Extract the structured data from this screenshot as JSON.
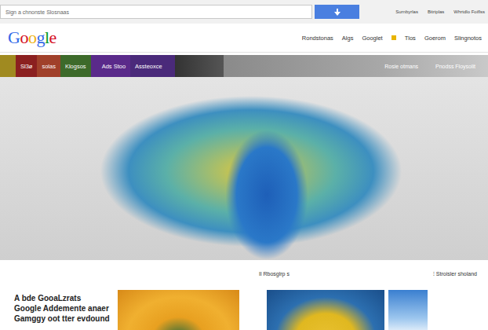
{
  "search": {
    "value": "Sign a chnonste Slosnaas"
  },
  "top_links": [
    "Surnbyrlas",
    "Bitriplas",
    "Whrtdlo Foiflss"
  ],
  "logo": "Google",
  "nav": [
    "Rondstonas",
    "Algs",
    "Googlet",
    "Tlos",
    "Goerom",
    "Slingnotos"
  ],
  "tabs": [
    {
      "label": "Sl3ø",
      "selected": false,
      "color": "#8b2020"
    },
    {
      "label": "solas",
      "selected": false,
      "color": "#a0402a"
    },
    {
      "label": "Klogsos",
      "selected": false,
      "color": "#3d6a2a"
    },
    {
      "label": "Ads Stoo",
      "selected": false,
      "color": "#5a2a8a"
    },
    {
      "label": "Assteoxce",
      "selected": false,
      "color": "#4a2a7a"
    }
  ],
  "tab_right": [
    "Rosie otmans",
    "Pnodss Floysolit"
  ],
  "captions": [
    "Il Rbosglrp s",
    "⁝ Stroisler sholand"
  ],
  "promo": [
    "A bde GooaLzrats",
    "Google Addemente anaer",
    "Gamggy oot tter evdound"
  ]
}
